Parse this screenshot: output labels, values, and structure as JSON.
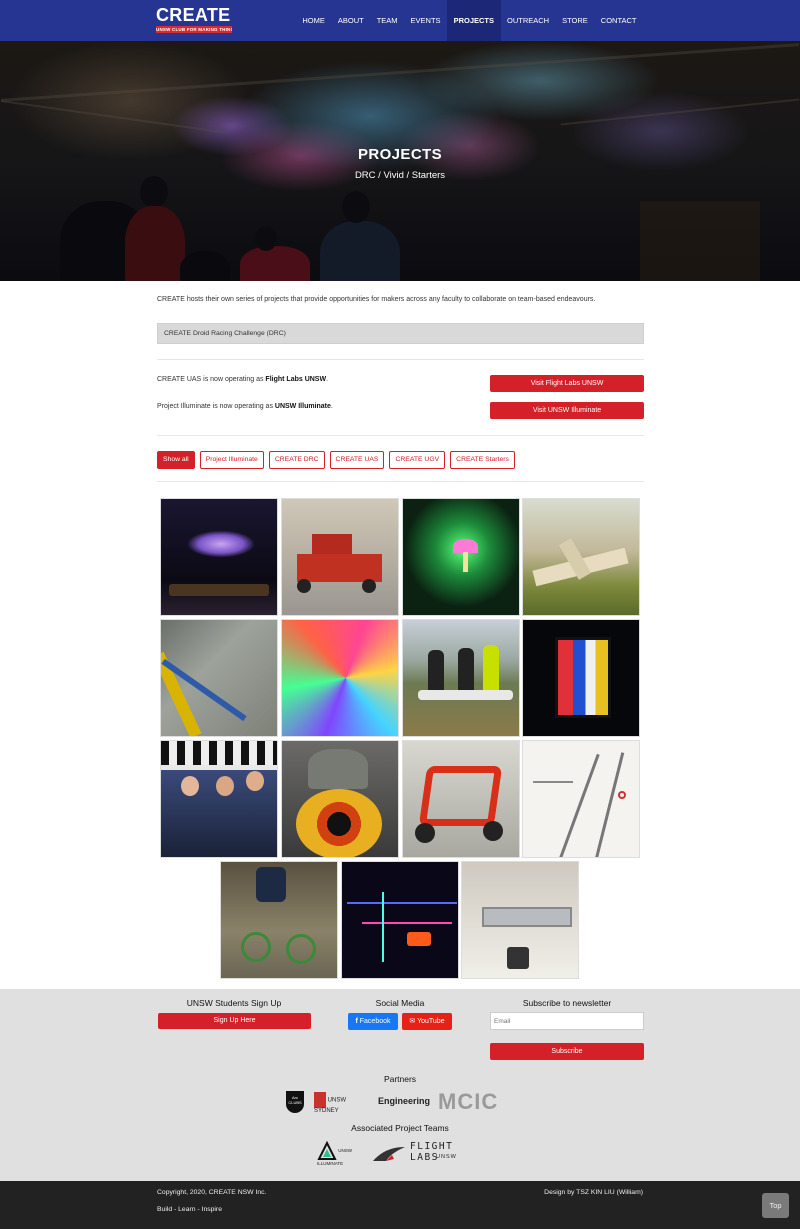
{
  "brand": {
    "title": "CREATE",
    "subtitle": "UNSW CLUB FOR MAKING THINGS"
  },
  "nav": [
    {
      "label": "HOME",
      "active": false
    },
    {
      "label": "ABOUT",
      "active": false
    },
    {
      "label": "TEAM",
      "active": false
    },
    {
      "label": "EVENTS",
      "active": false
    },
    {
      "label": "PROJECTS",
      "active": true
    },
    {
      "label": "OUTREACH",
      "active": false
    },
    {
      "label": "STORE",
      "active": false
    },
    {
      "label": "CONTACT",
      "active": false
    }
  ],
  "hero": {
    "title": "PROJECTS",
    "subtitle": "DRC / Vivid / Starters"
  },
  "intro": "CREATE hosts their own series of projects that provide opportunities for makers across any faculty to collaborate on team-based endeavours.",
  "drc_panel": "CREATE Droid Racing Challenge (DRC)",
  "operating": [
    {
      "prefix": "CREATE UAS is now operating as ",
      "name": "Flight Labs UNSW",
      "button": "Visit Flight Labs UNSW"
    },
    {
      "prefix": "Project Illuminate is now operating as ",
      "name": "UNSW Illuminate",
      "button": "Visit UNSW Illuminate"
    }
  ],
  "filters": [
    "Show all",
    "Project Illuminate",
    "CREATE DRC",
    "CREATE UAS",
    "CREATE UGV",
    "CREATE Starters"
  ],
  "gallery": [
    "Illuminate canopy light installation",
    "Red DRC robot car",
    "Glowing mushroom lights",
    "Fixed-wing UAS model",
    "DRC racing track",
    "Stained glass light wall",
    "UAS team with drone",
    "Mondrian light cube",
    "DRC team at start line",
    "BB-8 style droid",
    "Red UGV frame",
    "Bridge sketch",
    "Light-up bicycle installation",
    "Glowing floor maze",
    "CNC linear rail build"
  ],
  "footer": {
    "signup_title": "UNSW Students Sign Up",
    "signup_button": "Sign Up Here",
    "social_title": "Social Media",
    "facebook": "Facebook",
    "youtube": "YouTube",
    "newsletter_title": "Subscribe to newsletter",
    "email_placeholder": "Email",
    "subscribe_button": "Subscribe",
    "partners_title": "Partners",
    "partners": {
      "arc": "Arc CLUBS",
      "unsw": "UNSW SYDNEY",
      "engineering": "Engineering",
      "mcic": "MCIC"
    },
    "associated_title": "Associated Project Teams",
    "associated": {
      "illuminate": "UNSW ILLUMINATE",
      "flightlabs_top": "FLIGHT LABS",
      "flightlabs_sub": "UNSW"
    }
  },
  "bottom": {
    "copyright": "Copyright, 2020, CREATE NSW Inc.",
    "motto": "Build - Learn - Inspire",
    "design": "Design by TSZ KIN LIU (William)",
    "top": "Top"
  },
  "colors": {
    "nav_bg": "#263592",
    "accent_red": "#d42029",
    "facebook": "#1877f2",
    "youtube": "#e62117",
    "footer_bg": "#e0e0e0",
    "bottom_bg": "#222222"
  }
}
